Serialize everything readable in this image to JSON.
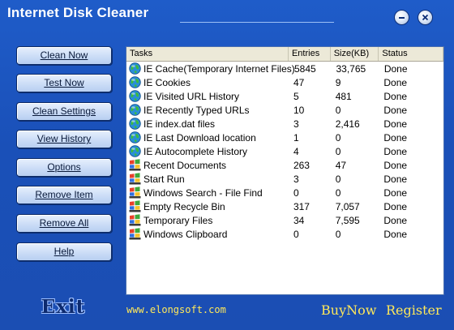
{
  "window": {
    "title": "Internet Disk Cleaner"
  },
  "sidebar": {
    "buttons": [
      {
        "label": "Clean Now"
      },
      {
        "label": "Test Now"
      },
      {
        "label": "Clean Settings"
      },
      {
        "label": "View History"
      },
      {
        "label": "Options"
      },
      {
        "label": "Remove Item"
      },
      {
        "label": "Remove All"
      },
      {
        "label": "Help"
      }
    ]
  },
  "table": {
    "headers": [
      "Tasks",
      "Entries",
      "Size(KB)",
      "Status"
    ],
    "rows": [
      {
        "icon": "globe-icon",
        "task": "IE Cache(Temporary Internet Files)",
        "entries": "5845",
        "size": "33,765",
        "status": "Done"
      },
      {
        "icon": "globe-icon",
        "task": "IE Cookies",
        "entries": "47",
        "size": "9",
        "status": "Done"
      },
      {
        "icon": "globe-icon",
        "task": "IE Visited URL History",
        "entries": "5",
        "size": "481",
        "status": "Done"
      },
      {
        "icon": "globe-icon",
        "task": "IE Recently Typed URLs",
        "entries": "10",
        "size": "0",
        "status": "Done"
      },
      {
        "icon": "globe-icon",
        "task": "IE index.dat files",
        "entries": "3",
        "size": "2,416",
        "status": "Done"
      },
      {
        "icon": "globe-icon",
        "task": "IE Last Download location",
        "entries": "1",
        "size": "0",
        "status": "Done"
      },
      {
        "icon": "globe-icon",
        "task": "IE Autocomplete History",
        "entries": "4",
        "size": "0",
        "status": "Done"
      },
      {
        "icon": "windows-icon",
        "task": "Recent Documents",
        "entries": "263",
        "size": "47",
        "status": "Done"
      },
      {
        "icon": "windows-icon",
        "task": "Start Run",
        "entries": "3",
        "size": "0",
        "status": "Done"
      },
      {
        "icon": "windows-icon",
        "task": "Windows Search - File Find",
        "entries": "0",
        "size": "0",
        "status": "Done"
      },
      {
        "icon": "windows-icon",
        "task": "Empty Recycle Bin",
        "entries": "317",
        "size": "7,057",
        "status": "Done"
      },
      {
        "icon": "windows-icon",
        "task": "Temporary Files",
        "entries": "34",
        "size": "7,595",
        "status": "Done"
      },
      {
        "icon": "windows-icon",
        "task": "Windows Clipboard",
        "entries": "0",
        "size": "0",
        "status": "Done"
      }
    ]
  },
  "footer": {
    "exit_label": "Exit",
    "website": "www.elongsoft.com",
    "buynow": "BuyNow",
    "register": "Register"
  },
  "colors": {
    "background": "#1b4eb3",
    "link": "#ffe85a",
    "button_face": "#c9dbf6"
  }
}
